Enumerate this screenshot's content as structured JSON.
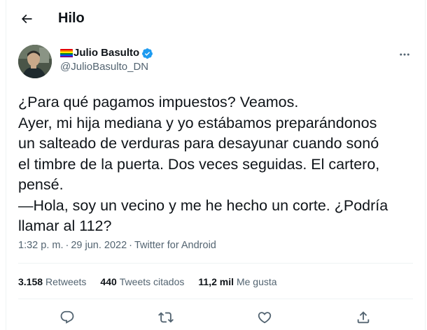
{
  "header": {
    "title": "Hilo"
  },
  "author": {
    "display_name": "Julio Basulto",
    "handle": "@JulioBasulto_DN",
    "verified": true,
    "flag_colors": [
      "#e40303",
      "#ff8c00",
      "#ffed00",
      "#008026",
      "#004dff",
      "#750787"
    ]
  },
  "tweet": {
    "lines": [
      "¿Para qué pagamos impuestos? Veamos.",
      "Ayer, mi hija mediana y yo estábamos preparándonos",
      "un salteado de verduras para desayunar cuando sonó",
      "el timbre de la puerta. Dos veces seguidas. El cartero,",
      "pensé.",
      "—Hola, soy un vecino y me he hecho un corte. ¿Podría",
      "llamar al 112?"
    ],
    "time": "1:32 p. m.",
    "separator": "·",
    "date": "29 jun. 2022",
    "source": "Twitter for Android"
  },
  "stats": {
    "retweets_count": "3.158",
    "retweets_label": "Retweets",
    "quotes_count": "440",
    "quotes_label": "Tweets citados",
    "likes_count": "11,2 mil",
    "likes_label": "Me gusta"
  },
  "icons": {
    "back": "arrow-left-icon",
    "verified": "verified-badge-icon",
    "more": "more-dots-icon",
    "reply": "reply-icon",
    "retweet": "retweet-icon",
    "like": "heart-icon",
    "share": "share-icon"
  },
  "colors": {
    "verified": "#1d9bf0",
    "text": "#0f1419",
    "secondary": "#536471",
    "divider": "#eff3f4"
  }
}
